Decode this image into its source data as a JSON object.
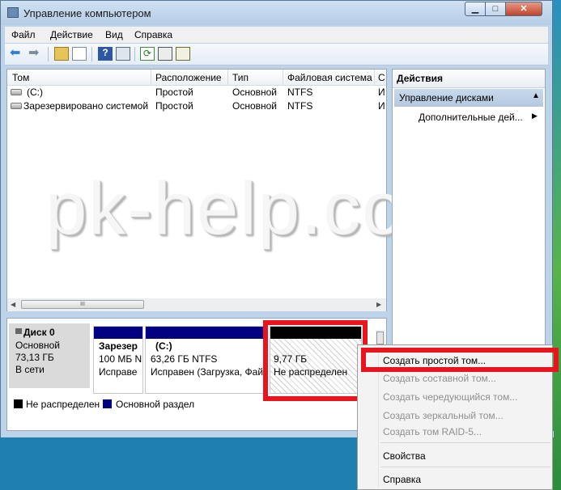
{
  "window": {
    "title": "Управление компьютером",
    "controls": {
      "minimize": "▁",
      "maximize": "□",
      "close": "✕"
    }
  },
  "menu": [
    "Файл",
    "Действие",
    "Вид",
    "Справка"
  ],
  "toolbar": {
    "help_glyph": "?",
    "refresh_glyph": "⟳"
  },
  "volumes": {
    "columns": [
      "Том",
      "Расположение",
      "Тип",
      "Файловая система",
      "С"
    ],
    "rows": [
      {
        "name": "(C:)",
        "layout": "Простой",
        "type": "Основной",
        "fs": "NTFS",
        "status": "И"
      },
      {
        "name": "Зарезервировано системой",
        "layout": "Простой",
        "type": "Основной",
        "fs": "NTFS",
        "status": "И"
      }
    ],
    "scroll_thumb": "III"
  },
  "watermark": "pk-help.com",
  "actions": {
    "title": "Действия",
    "group": "Управление дисками",
    "sub": "Дополнительные дей..."
  },
  "disk": {
    "name": "Диск 0",
    "type": "Основной",
    "size": "73,13 ГБ",
    "status": "В сети",
    "partitions": [
      {
        "title": "Зарезер",
        "size": "100 МБ N",
        "state": "Исправе"
      },
      {
        "title": "(C:)",
        "size": "63,26 ГБ NTFS",
        "state": "Исправен (Загрузка, Фай"
      },
      {
        "title": "",
        "size": "9,77 ГБ",
        "state": "Не распределен"
      }
    ]
  },
  "legend": [
    {
      "label": "Не распределен",
      "color": "#000000"
    },
    {
      "label": "Основной раздел",
      "color": "#000080"
    }
  ],
  "context_menu": {
    "items": [
      {
        "label": "Создать простой том...",
        "enabled": true
      },
      {
        "label": "Создать составной том...",
        "enabled": false
      },
      {
        "label": "Создать чередующийся том...",
        "enabled": false
      },
      {
        "label": "Создать зеркальный том...",
        "enabled": false
      },
      {
        "label": "Создать том RAID-5...",
        "enabled": false
      },
      {
        "label": "Свойства",
        "enabled": true
      },
      {
        "label": "Справка",
        "enabled": true
      }
    ]
  },
  "colors": {
    "highlight": "#e8141e",
    "primary_partition": "#000080",
    "unallocated": "#000000"
  }
}
